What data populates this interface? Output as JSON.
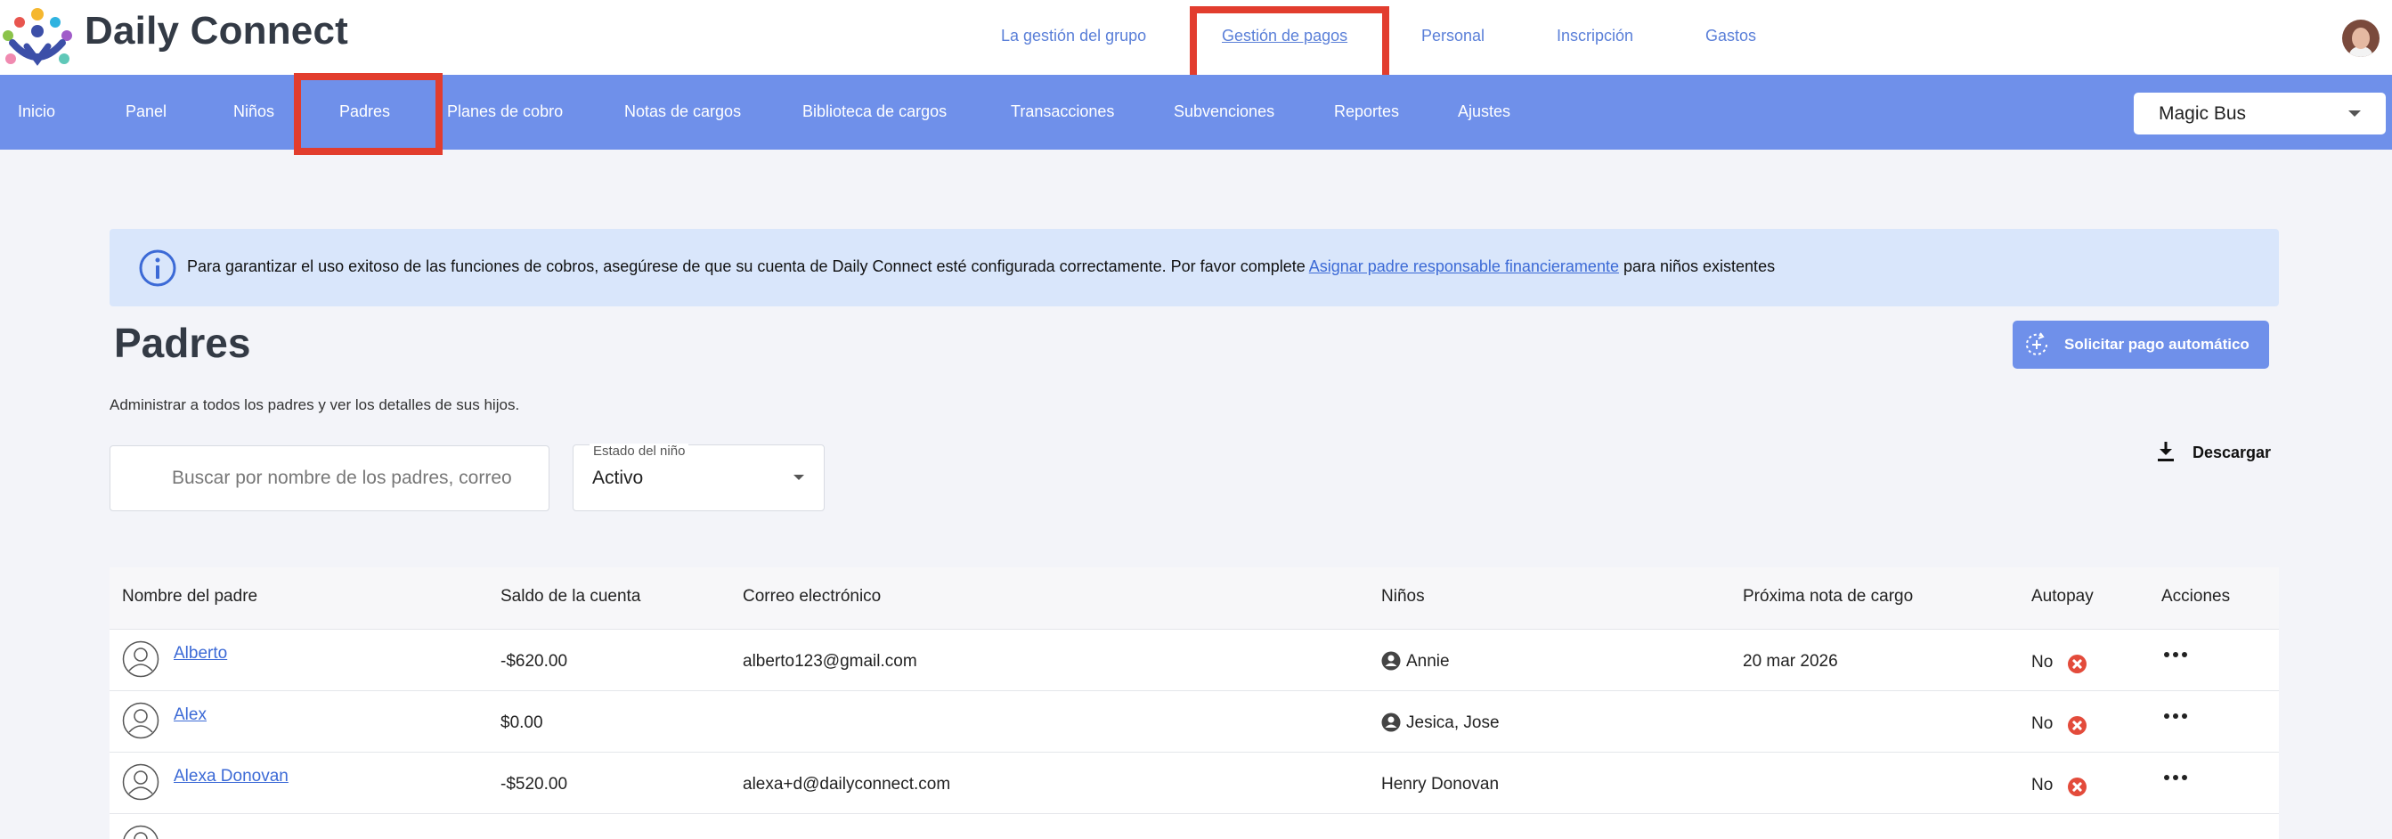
{
  "brand": {
    "name": "Daily Connect"
  },
  "top_nav": [
    {
      "label": "La gestión del grupo",
      "active": false
    },
    {
      "label": "Gestión de pagos",
      "active": true
    },
    {
      "label": "Personal",
      "active": false
    },
    {
      "label": "Inscripción",
      "active": false
    },
    {
      "label": "Gastos",
      "active": false
    }
  ],
  "sub_nav": [
    {
      "label": "Inicio"
    },
    {
      "label": "Panel"
    },
    {
      "label": "Niños"
    },
    {
      "label": "Padres",
      "active": true
    },
    {
      "label": "Planes de cobro"
    },
    {
      "label": "Notas de cargos"
    },
    {
      "label": "Biblioteca de cargos"
    },
    {
      "label": "Transacciones"
    },
    {
      "label": "Subvenciones"
    },
    {
      "label": "Reportes"
    },
    {
      "label": "Ajustes"
    }
  ],
  "school_select": {
    "value": "Magic Bus"
  },
  "alert": {
    "text_before": "Para garantizar el uso exitoso de las funciones de cobros, asegúrese de que su cuenta de Daily Connect esté configurada correctamente. Por favor complete ",
    "link": "Asignar padre responsable financieramente",
    "text_after": " para niños existentes"
  },
  "page": {
    "title": "Padres",
    "subtitle": "Administrar a todos los padres y ver los detalles de sus hijos.",
    "autopay_button": "Solicitar pago automático",
    "download_button": "Descargar"
  },
  "filters": {
    "search_placeholder": "Buscar por nombre de los padres, correo",
    "status_label": "Estado del niño",
    "status_value": "Activo"
  },
  "table": {
    "headers": {
      "name": "Nombre del padre",
      "balance": "Saldo de la cuenta",
      "email": "Correo electrónico",
      "children": "Niños",
      "next_charge": "Próxima nota de cargo",
      "autopay": "Autopay",
      "actions": "Acciones"
    },
    "rows": [
      {
        "name": "Alberto",
        "balance": "-$620.00",
        "email": "alberto123@gmail.com",
        "children": "Annie",
        "child_icon": true,
        "next_charge": "20 mar 2026",
        "autopay": "No"
      },
      {
        "name": "Alex",
        "balance": "$0.00",
        "email": "",
        "children": "Jesica, Jose",
        "child_icon": true,
        "next_charge": "",
        "autopay": "No"
      },
      {
        "name": "Alexa Donovan",
        "balance": "-$520.00",
        "email": "alexa+d@dailyconnect.com",
        "children": "Henry Donovan",
        "child_icon": false,
        "next_charge": "",
        "autopay": "No"
      }
    ]
  },
  "colors": {
    "primary": "#6f90ea",
    "link": "#3c6ad6",
    "highlight": "#e23d2e",
    "alert_bg": "#d9e6fb",
    "error": "#e34b3b"
  }
}
